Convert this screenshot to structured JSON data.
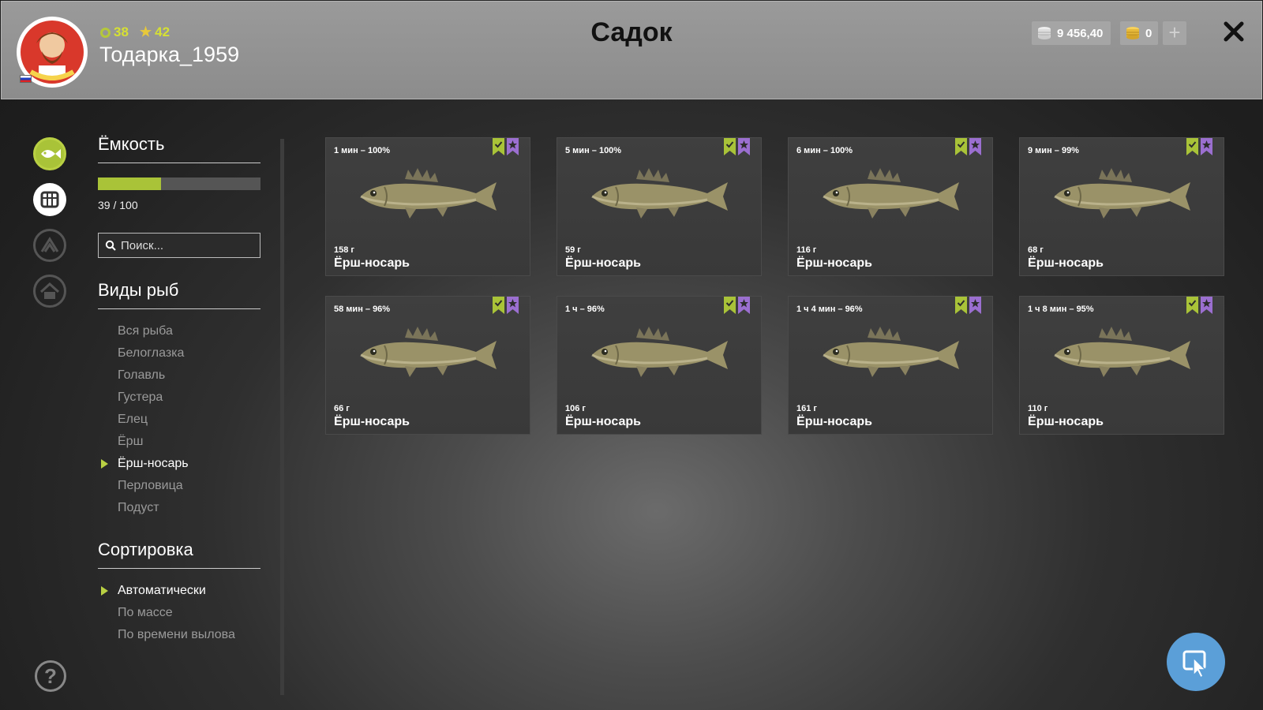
{
  "header": {
    "level": "38",
    "stars": "42",
    "username": "Тодарка_1959",
    "title": "Садок",
    "silver": "9 456,40",
    "gold": "0",
    "plus_label": "+"
  },
  "rail": {
    "help_label": "?"
  },
  "capacity": {
    "title": "Ёмкость",
    "current": 39,
    "max": 100,
    "fraction": 0.39,
    "label": "39 / 100"
  },
  "search": {
    "placeholder": "Поиск..."
  },
  "species": {
    "title": "Виды рыб",
    "items": [
      {
        "label": "Вся рыба",
        "active": false
      },
      {
        "label": "Белоглазка",
        "active": false
      },
      {
        "label": "Голавль",
        "active": false
      },
      {
        "label": "Густера",
        "active": false
      },
      {
        "label": "Елец",
        "active": false
      },
      {
        "label": "Ёрш",
        "active": false
      },
      {
        "label": "Ёрш-носарь",
        "active": true
      },
      {
        "label": "Перловица",
        "active": false
      },
      {
        "label": "Подуст",
        "active": false
      }
    ]
  },
  "sorting": {
    "title": "Сортировка",
    "items": [
      {
        "label": "Автоматически",
        "active": true
      },
      {
        "label": "По массе",
        "active": false
      },
      {
        "label": "По времени вылова",
        "active": false
      }
    ]
  },
  "fish": [
    {
      "time": "1 мин – 100%",
      "weight": "158 г",
      "name": "Ёрш-носарь"
    },
    {
      "time": "5 мин – 100%",
      "weight": "59 г",
      "name": "Ёрш-носарь"
    },
    {
      "time": "6 мин – 100%",
      "weight": "116 г",
      "name": "Ёрш-носарь"
    },
    {
      "time": "9 мин – 99%",
      "weight": "68 г",
      "name": "Ёрш-носарь"
    },
    {
      "time": "58 мин – 96%",
      "weight": "66 г",
      "name": "Ёрш-носарь"
    },
    {
      "time": "1 ч – 96%",
      "weight": "106 г",
      "name": "Ёрш-носарь"
    },
    {
      "time": "1 ч 4 мин – 96%",
      "weight": "161 г",
      "name": "Ёрш-носарь"
    },
    {
      "time": "1 ч 8 мин – 95%",
      "weight": "110 г",
      "name": "Ёрш-носарь"
    }
  ],
  "colors": {
    "accent_green": "#a9c338",
    "accent_purple": "#9b6fd0",
    "cursor_button": "#5b9fd8"
  },
  "icons": {
    "rail": [
      "fish-icon",
      "keepnet-icon",
      "upgrade-icon",
      "home-icon",
      "help-icon"
    ],
    "card_marks": [
      "check-bookmark-icon",
      "star-bookmark-icon"
    ]
  }
}
